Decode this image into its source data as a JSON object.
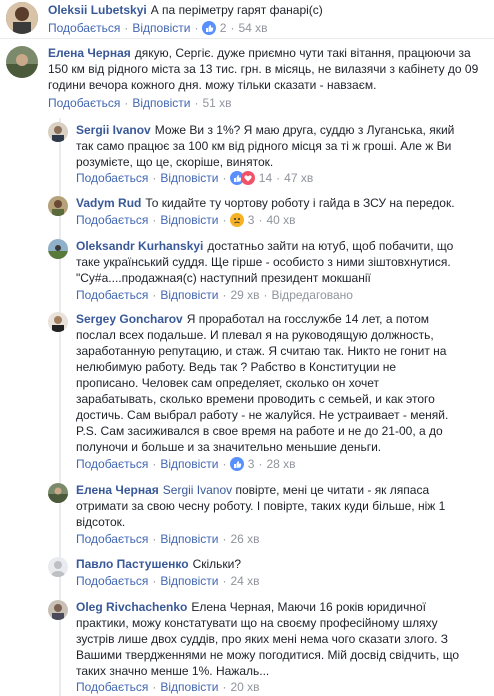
{
  "comments": [
    {
      "author": "Oleksii Lubetskyi",
      "text": "А па перiметру гарят фанарі(с)",
      "like": "Подобається",
      "reply": "Відповісти",
      "time": "54 хв",
      "reactions": "2"
    },
    {
      "author": "Елена Черная",
      "text": "дякую, Сергіє. дуже приємно чути такі вітання, працюючи за 150 км від рідного міста за 13 тис. грн. в місяць, не вилазячи з кабінету до 09 години вечора кожного дня. можу тільки сказати - навзаєм.",
      "like": "Подобається",
      "reply": "Відповісти",
      "time": "51 хв"
    },
    {
      "author": "Sergii Ivanov",
      "text": "Може Ви з 1%? Я маю друга, суддю з Луганська, який так само працює за 100 км від рідного місця за ті ж гроші. Але ж Ви розумієте, що це, скоріше, виняток.",
      "like": "Подобається",
      "reply": "Відповісти",
      "time": "47 хв",
      "reactions": "14"
    },
    {
      "author": "Vadym Rud",
      "text": "То кидайте ту чортову роботу і гайда в ЗСУ на передок.",
      "like": "Подобається",
      "reply": "Відповісти",
      "time": "40 хв",
      "reactions": "3"
    },
    {
      "author": "Oleksandr Kurhanskyi",
      "text": "достатньо зайти на ютуб, щоб побачити, що таке український суддя. Ще гірше - особисто з ними зіштовхнутися. \"Су#а....продажная(с) наступний президент мокшанії",
      "like": "Подобається",
      "reply": "Відповісти",
      "time": "29 хв",
      "edited": "Відредаговано"
    },
    {
      "author": "Sergey Goncharov",
      "text": "Я проработал на госслужбе 14 лет, а потом послал всех подальше. И плевал я на руководящую должность, заработанную репутацию, и стаж. Я считаю так. Никто не гонит на нелюбимую работу. Ведь так ? Рабство в Конституции не прописано. Человек сам определяет, сколько он хочет зарабатывать, сколько времени проводить с семьей, и как этого достичь. Сам выбрал работу - не жалуйся. Не устраивает - меняй. P.S. Сам засиживался в свое время на работе и не до 21-00, а до полуночи и больше и за значительно меньшие деньги.",
      "like": "Подобається",
      "reply": "Відповісти",
      "time": "28 хв",
      "reactions": "3"
    },
    {
      "author": "Елена Черная",
      "mention": "Sergii Ivanov",
      "text": " повірте, мені це читати - як ляпаса отримати за свою чесну роботу. І повірте, таких куди більше, ніж 1 відсоток.",
      "like": "Подобається",
      "reply": "Відповісти",
      "time": "26 хв"
    },
    {
      "author": "Павло Пастушенко",
      "text": "Скільки?",
      "like": "Подобається",
      "reply": "Відповісти",
      "time": "24 хв"
    },
    {
      "author": "Oleg Rivchachenko",
      "text": "Елена Черная, Маючи 16 років юридичної практики, можу констатувати що на своєму професійному шляху зустрів лише двох суддів, про яких мені нема чого сказати злого. З Вашими твердженнями не можу погодитися. Мій досвід свідчить, що таких значно менше 1%. Нажаль...",
      "like": "Подобається",
      "reply": "Відповісти",
      "time": "20 хв"
    }
  ],
  "colors": {
    "link": "#385898",
    "action": "#4267b2",
    "meta": "#90949c",
    "like_blue": "#5890ff",
    "angry_orange": "#f7b125"
  }
}
